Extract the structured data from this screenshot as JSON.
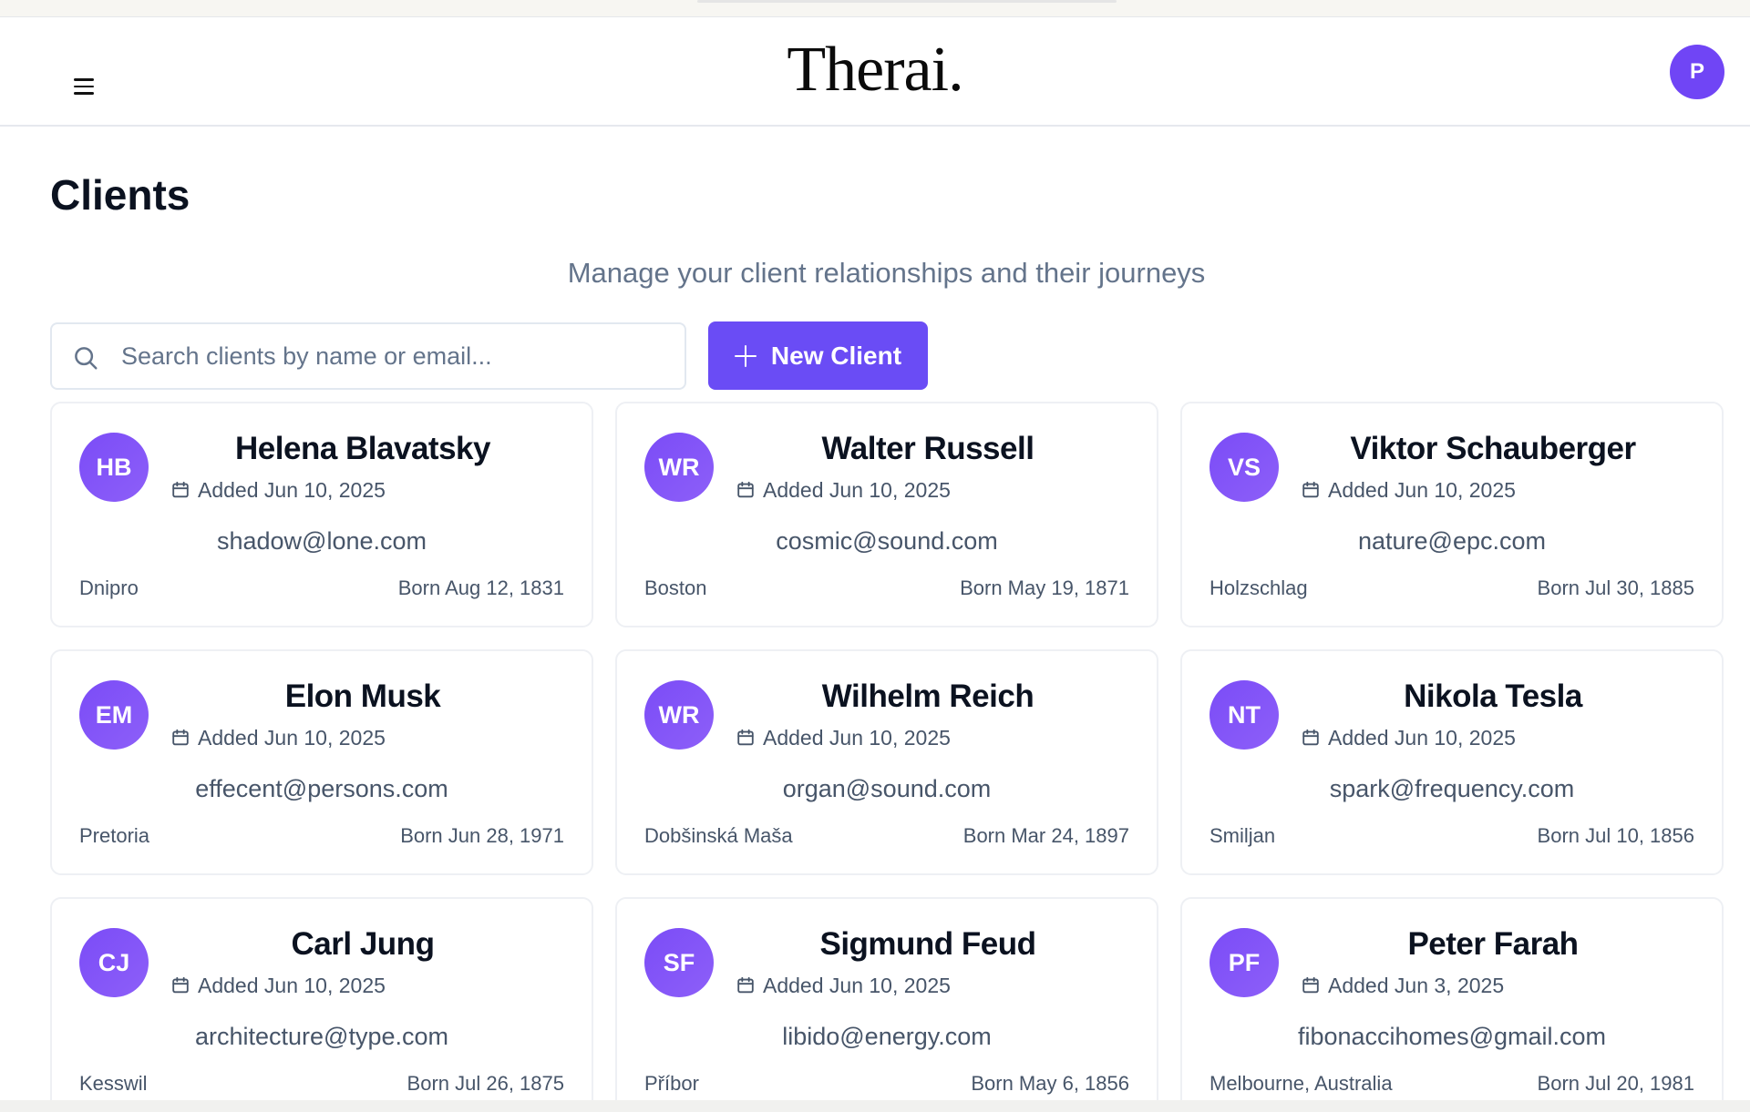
{
  "header": {
    "menu_icon": "hamburger-menu-icon",
    "logo": "Therai.",
    "user_initial": "P"
  },
  "page": {
    "title": "Clients",
    "subtitle": "Manage your client relationships and their journeys"
  },
  "search": {
    "placeholder": "Search clients by name or email...",
    "value": ""
  },
  "actions": {
    "new_client_label": "New Client"
  },
  "colors": {
    "accent": "#6a4cf5",
    "avatar": "#7b4cf7"
  },
  "clients": [
    {
      "initials": "HB",
      "name": "Helena Blavatsky",
      "added": "Added Jun 10, 2025",
      "email": "shadow@lone.com",
      "city": "Dnipro",
      "born": "Born Aug 12, 1831"
    },
    {
      "initials": "WR",
      "name": "Walter Russell",
      "added": "Added Jun 10, 2025",
      "email": "cosmic@sound.com",
      "city": "Boston",
      "born": "Born May 19, 1871"
    },
    {
      "initials": "VS",
      "name": "Viktor Schauberger",
      "added": "Added Jun 10, 2025",
      "email": "nature@epc.com",
      "city": "Holzschlag",
      "born": "Born Jul 30, 1885"
    },
    {
      "initials": "EM",
      "name": "Elon Musk",
      "added": "Added Jun 10, 2025",
      "email": "effecent@persons.com",
      "city": "Pretoria",
      "born": "Born Jun 28, 1971"
    },
    {
      "initials": "WR",
      "name": "Wilhelm Reich",
      "added": "Added Jun 10, 2025",
      "email": "organ@sound.com",
      "city": "Dobšinská Maša",
      "born": "Born Mar 24, 1897"
    },
    {
      "initials": "NT",
      "name": "Nikola Tesla",
      "added": "Added Jun 10, 2025",
      "email": "spark@frequency.com",
      "city": "Smiljan",
      "born": "Born Jul 10, 1856"
    },
    {
      "initials": "CJ",
      "name": "Carl Jung",
      "added": "Added Jun 10, 2025",
      "email": "architecture@type.com",
      "city": "Kesswil",
      "born": "Born Jul 26, 1875"
    },
    {
      "initials": "SF",
      "name": "Sigmund Feud",
      "added": "Added Jun 10, 2025",
      "email": "libido@energy.com",
      "city": "Příbor",
      "born": "Born May 6, 1856"
    },
    {
      "initials": "PF",
      "name": "Peter Farah",
      "added": "Added Jun 3, 2025",
      "email": "fibonaccihomes@gmail.com",
      "city": "Melbourne, Australia",
      "born": "Born Jul 20, 1981"
    }
  ]
}
